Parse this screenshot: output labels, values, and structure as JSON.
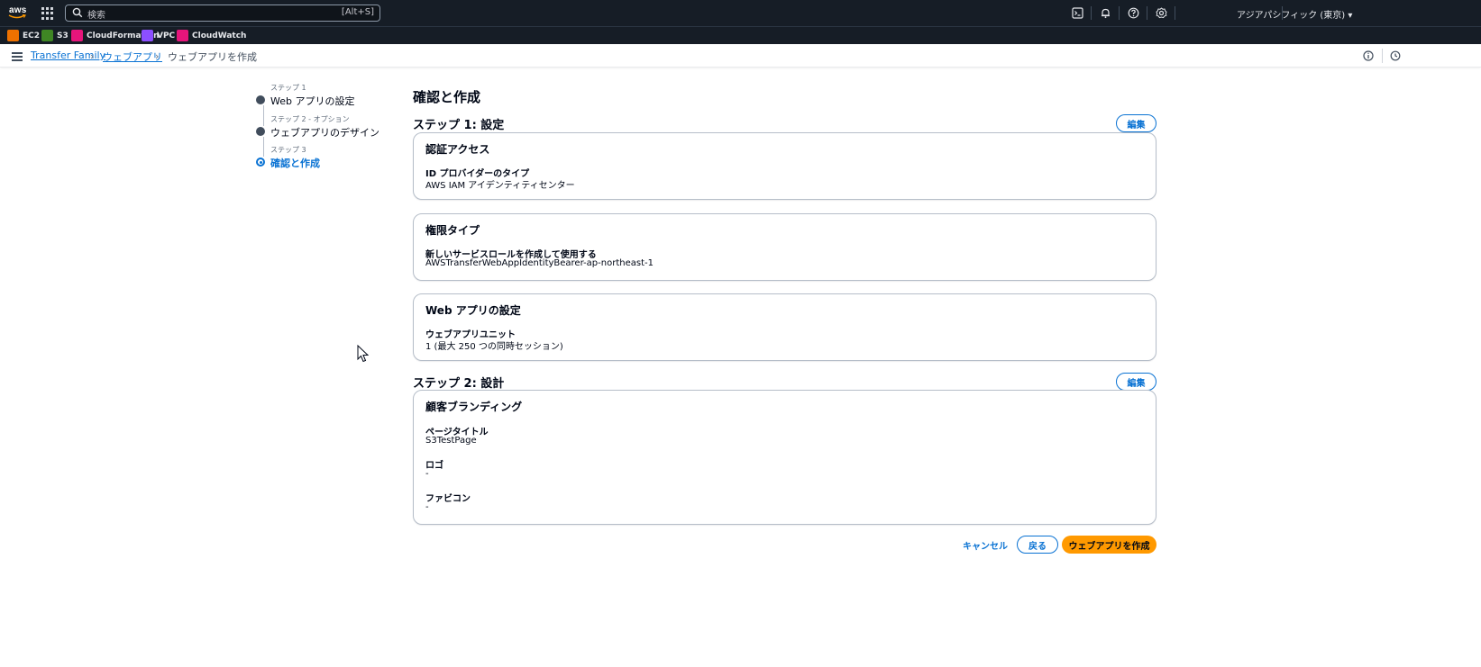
{
  "topnav": {
    "logo_text": "aws",
    "search_placeholder": "検索",
    "search_shortcut": "[Alt+S]",
    "region": "アジアパシフィック (東京) ▾"
  },
  "shortcuts": [
    {
      "label": "EC2",
      "color": "#ed7100"
    },
    {
      "label": "S3",
      "color": "#3f8624"
    },
    {
      "label": "CloudFormation",
      "color": "#e7157b"
    },
    {
      "label": "VPC",
      "color": "#8c4fff"
    },
    {
      "label": "CloudWatch",
      "color": "#e7157b"
    }
  ],
  "breadcrumb": {
    "items": [
      "Transfer Family",
      "ウェブアプリ",
      "ウェブアプリを作成"
    ]
  },
  "wizard": {
    "steps": [
      {
        "label": "ステップ 1",
        "title": "Web アプリの設定"
      },
      {
        "label": "ステップ 2 - オプション",
        "title": "ウェブアプリのデザイン"
      },
      {
        "label": "ステップ 3",
        "title": "確認と作成"
      }
    ]
  },
  "main": {
    "title": "確認と作成",
    "step1": {
      "heading": "ステップ 1: 設定",
      "edit_label": "編集",
      "cards": [
        {
          "title": "認証アクセス",
          "fields": [
            {
              "key": "ID プロバイダーのタイプ",
              "value": "AWS IAM アイデンティティセンター"
            }
          ]
        },
        {
          "title": "権限タイプ",
          "fields": [
            {
              "key": "新しいサービスロールを作成して使用する",
              "value": "AWSTransferWebAppIdentityBearer-ap-northeast-1"
            }
          ]
        },
        {
          "title": "Web アプリの設定",
          "fields": [
            {
              "key": "ウェブアプリユニット",
              "value": "1 (最大 250 つの同時セッション)"
            }
          ]
        }
      ]
    },
    "step2": {
      "heading": "ステップ 2: 設計",
      "edit_label": "編集",
      "card": {
        "title": "顧客ブランディング",
        "fields": [
          {
            "key": "ページタイトル",
            "value": "S3TestPage"
          },
          {
            "key": "ロゴ",
            "value": "-"
          },
          {
            "key": "ファビコン",
            "value": "-"
          }
        ]
      }
    },
    "actions": {
      "cancel": "キャンセル",
      "back": "戻る",
      "create": "ウェブアプリを作成"
    }
  },
  "colors": {
    "nav_bg": "#161d26",
    "link": "#0972d3",
    "primary": "#ff9900",
    "border": "#b6bec9"
  }
}
